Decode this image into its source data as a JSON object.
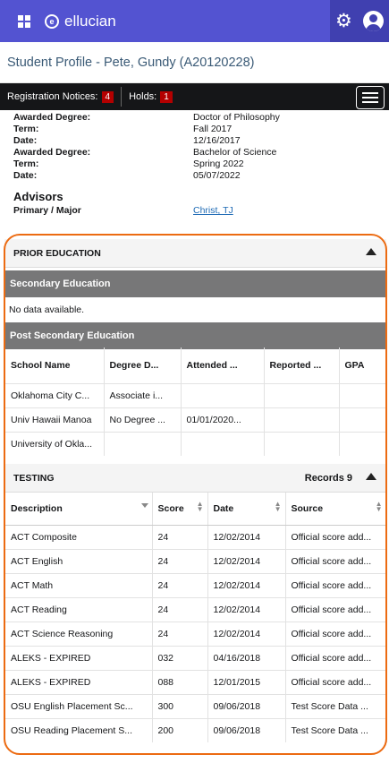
{
  "brand": {
    "name": "ellucian"
  },
  "page": {
    "title": "Student Profile - Pete, Gundy (A20120228)"
  },
  "notices": {
    "registration_label": "Registration Notices:",
    "registration_count": "4",
    "holds_label": "Holds:",
    "holds_count": "1"
  },
  "degrees": [
    {
      "label": "Awarded Degree:",
      "value": "Doctor of Philosophy"
    },
    {
      "label": "Term:",
      "value": "Fall 2017"
    },
    {
      "label": "Date:",
      "value": "12/16/2017"
    },
    {
      "label": "Awarded Degree:",
      "value": "Bachelor of Science"
    },
    {
      "label": "Term:",
      "value": "Spring 2022"
    },
    {
      "label": "Date:",
      "value": "05/07/2022"
    }
  ],
  "advisors": {
    "heading": "Advisors",
    "label": "Primary / Major",
    "name": "Christ, TJ"
  },
  "prior_education": {
    "heading": "PRIOR EDUCATION",
    "secondary_heading": "Secondary Education",
    "no_data": "No data available.",
    "post_secondary_heading": "Post Secondary Education",
    "columns": [
      "School Name",
      "Degree D...",
      "Attended ...",
      "Reported ...",
      "GPA"
    ],
    "rows": [
      [
        "Oklahoma City C...",
        "Associate i...",
        "",
        "",
        ""
      ],
      [
        "Univ Hawaii Manoa",
        "No Degree ...",
        "01/01/2020...",
        "",
        ""
      ],
      [
        "University of Okla...",
        "",
        "",
        "",
        ""
      ]
    ]
  },
  "testing": {
    "heading": "TESTING",
    "records": "Records 9",
    "columns": [
      "Description",
      "Score",
      "Date",
      "Source"
    ],
    "rows": [
      [
        "ACT Composite",
        "24",
        "12/02/2014",
        "Official score add..."
      ],
      [
        "ACT English",
        "24",
        "12/02/2014",
        "Official score add..."
      ],
      [
        "ACT Math",
        "24",
        "12/02/2014",
        "Official score add..."
      ],
      [
        "ACT Reading",
        "24",
        "12/02/2014",
        "Official score add..."
      ],
      [
        "ACT Science Reasoning",
        "24",
        "12/02/2014",
        "Official score add..."
      ],
      [
        "ALEKS - EXPIRED",
        "032",
        "04/16/2018",
        "Official score add..."
      ],
      [
        "ALEKS - EXPIRED",
        "088",
        "12/01/2015",
        "Official score add..."
      ],
      [
        "OSU English Placement Sc...",
        "300",
        "09/06/2018",
        "Test Score Data ..."
      ],
      [
        "OSU Reading Placement S...",
        "200",
        "09/06/2018",
        "Test Score Data ..."
      ]
    ]
  },
  "colors": {
    "topbar": "#5353d1",
    "highlight_frame": "#ec6b12",
    "badge": "#b30000"
  }
}
